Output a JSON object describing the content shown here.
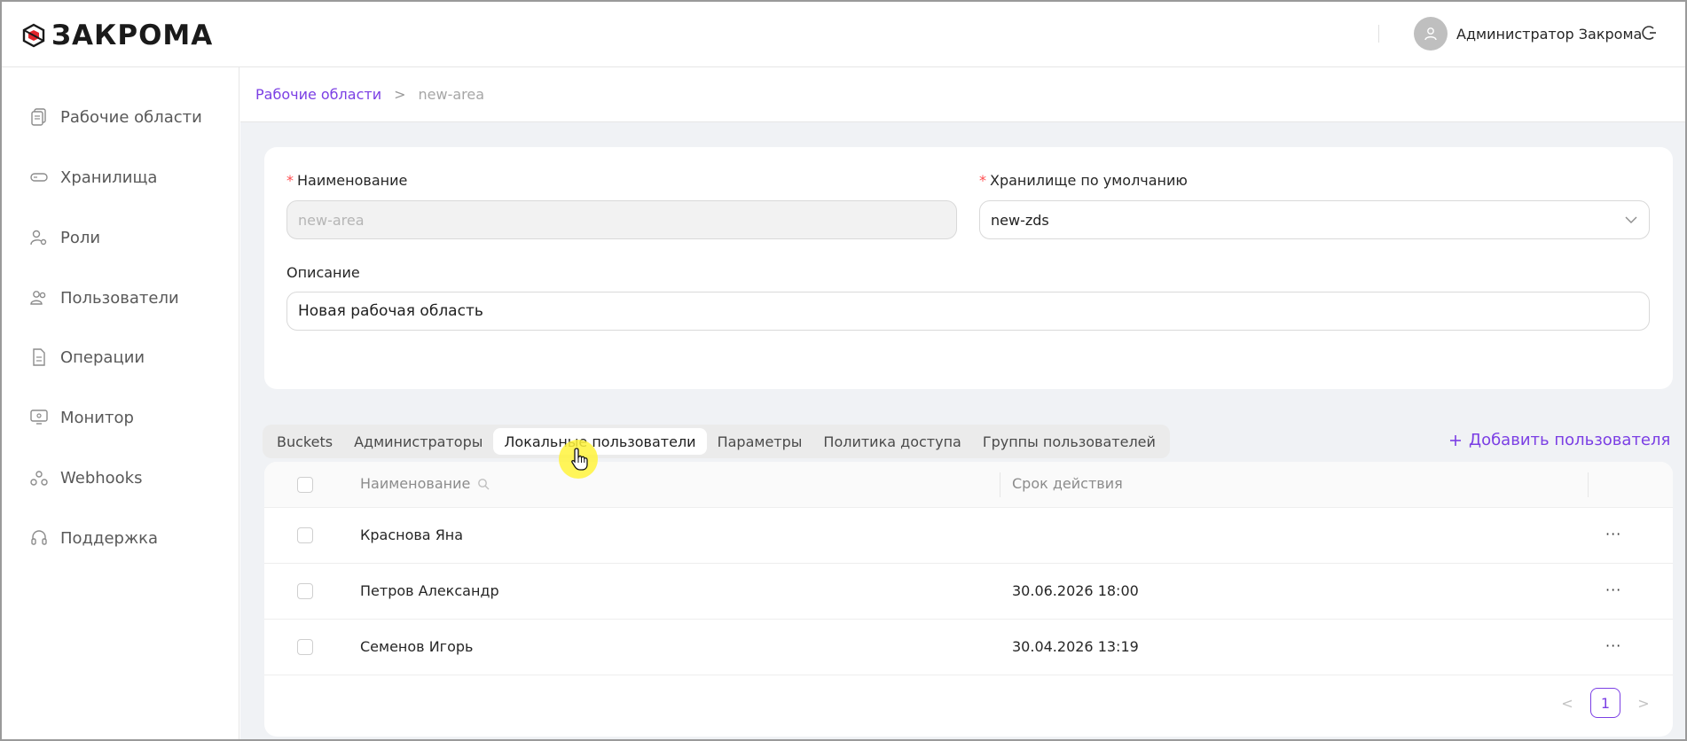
{
  "header": {
    "brand": "ЗАКРОМА",
    "user_name": "Администратор Закрома"
  },
  "sidebar": {
    "items": [
      {
        "label": "Рабочие области",
        "icon": "file-copy-icon"
      },
      {
        "label": "Хранилища",
        "icon": "storage-icon"
      },
      {
        "label": "Роли",
        "icon": "user-settings-icon"
      },
      {
        "label": "Пользователи",
        "icon": "users-icon"
      },
      {
        "label": "Операции",
        "icon": "document-icon"
      },
      {
        "label": "Монитор",
        "icon": "monitor-icon"
      },
      {
        "label": "Webhooks",
        "icon": "webhook-icon"
      },
      {
        "label": "Поддержка",
        "icon": "headset-icon"
      }
    ]
  },
  "breadcrumb": {
    "parent": "Рабочие области",
    "separator": ">",
    "current": "new-area"
  },
  "form": {
    "name_label": "Наименование",
    "name_value": "new-area",
    "storage_label": "Хранилище по умолчанию",
    "storage_value": "new-zds",
    "description_label": "Описание",
    "description_value": "Новая рабочая область",
    "required_mark": "*"
  },
  "tabs": [
    "Buckets",
    "Администраторы",
    "Локальные пользователи",
    "Параметры",
    "Политика доступа",
    "Группы пользователей"
  ],
  "active_tab": "Локальные пользователи",
  "add_user_label": "Добавить пользователя",
  "table": {
    "columns": [
      "Наименование",
      "Срок действия"
    ],
    "rows": [
      {
        "name": "Краснова Яна",
        "expires": ""
      },
      {
        "name": "Петров Александр",
        "expires": "30.06.2026 18:00"
      },
      {
        "name": "Семенов Игорь",
        "expires": "30.04.2026 13:19"
      }
    ],
    "more_label": "···"
  },
  "pagination": {
    "current_page": "1",
    "prev": "<",
    "next": ">"
  },
  "colors": {
    "accent": "#7b3fe4",
    "required": "#ff4d4f",
    "background": "#f0f2f5"
  }
}
